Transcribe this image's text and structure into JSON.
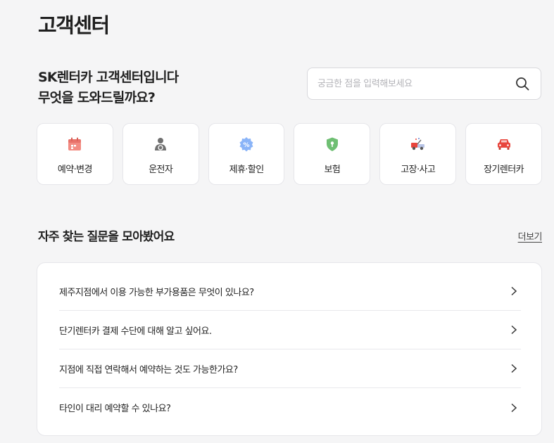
{
  "header": {
    "title": "고객센터"
  },
  "greeting": {
    "line1": "SK렌터카 고객센터입니다",
    "line2": "무엇을 도와드릴까요?"
  },
  "search": {
    "placeholder": "궁금한 점을 입력해보세요",
    "icon": "search-icon"
  },
  "categories": [
    {
      "label": "예약·변경",
      "icon": "calendar-icon",
      "color": "#f28b82"
    },
    {
      "label": "운전자",
      "icon": "driver-icon",
      "color": "#707070"
    },
    {
      "label": "제휴·할인",
      "icon": "discount-badge-icon",
      "color": "#8ab4f8"
    },
    {
      "label": "보험",
      "icon": "shield-icon",
      "color": "#6fbf73"
    },
    {
      "label": "고장·사고",
      "icon": "tow-truck-icon",
      "color": "#e8453c"
    },
    {
      "label": "장기렌터카",
      "icon": "car-icon",
      "color": "#e8453c"
    }
  ],
  "faq": {
    "title": "자주 찾는 질문을 모아봤어요",
    "more_label": "더보기",
    "items": [
      {
        "question": "제주지점에서 이용 가능한 부가용품은 무엇이 있나요?"
      },
      {
        "question": "단기렌터카 결제 수단에 대해 알고 싶어요."
      },
      {
        "question": "지점에 직접 연락해서 예약하는 것도 가능한가요?"
      },
      {
        "question": "타인이 대리 예약할 수 있나요?"
      }
    ]
  }
}
